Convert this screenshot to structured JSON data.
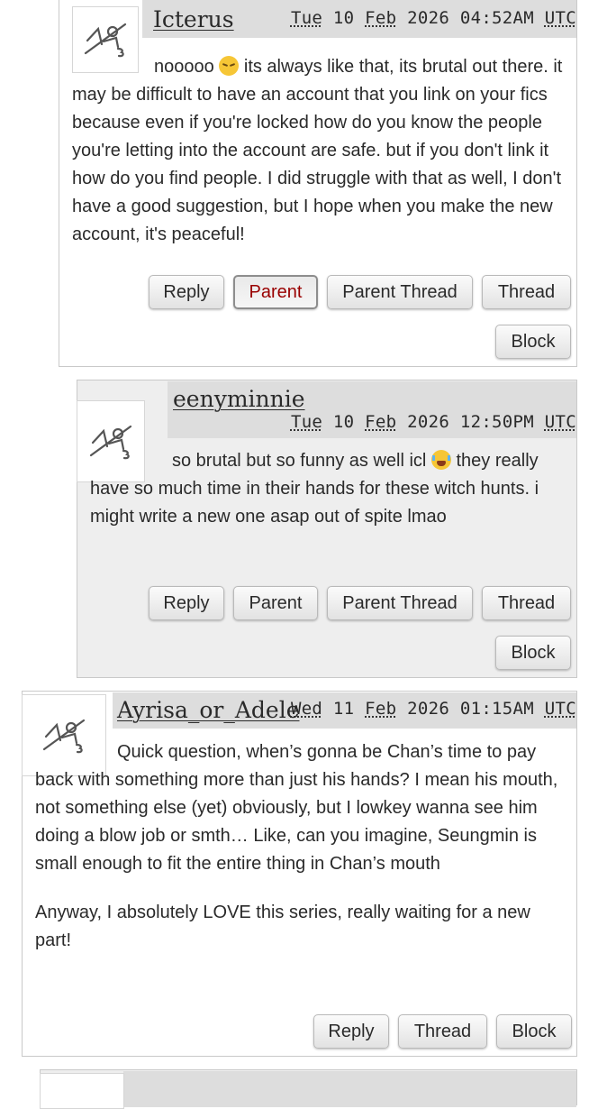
{
  "icons": {
    "default_avatar": "anonymous-user-icon"
  },
  "colors": {
    "active_link": "#990000",
    "nested_background": "#eeeeee",
    "byline_background": "#dddddd"
  },
  "comments": [
    {
      "username": "Icterus",
      "date": {
        "weekday": "Tue",
        "day": "10",
        "month": "Feb",
        "year": "2026",
        "time": "04:52AM",
        "zone": "UTC"
      },
      "body": [
        "nooooo",
        "its always like that, its brutal out there. it may be difficult to have an account that you link on your fics because even if you're locked how do you know the people you're letting into the account are safe. but if you don't link it how do you find people. I did struggle with that as well, I don't have a good suggestion, but I hope when you make the new account, it's peaceful!"
      ],
      "emoji": "pensive-face-icon",
      "actions": {
        "reply": "Reply",
        "parent": "Parent",
        "parent_thread": "Parent Thread",
        "thread": "Thread",
        "block": "Block"
      }
    },
    {
      "username": "eenyminnie",
      "date": {
        "weekday": "Tue",
        "day": "10",
        "month": "Feb",
        "year": "2026",
        "time": "12:50PM",
        "zone": "UTC"
      },
      "body": [
        "so brutal but so funny as well icl",
        "they really have so much time in their hands for these witch hunts. i might write a new one asap out of spite lmao"
      ],
      "emoji": "loudly-crying-face-icon",
      "actions": {
        "reply": "Reply",
        "parent": "Parent",
        "parent_thread": "Parent Thread",
        "thread": "Thread",
        "block": "Block"
      }
    },
    {
      "username": "Ayrisa_or_Adele",
      "date": {
        "weekday": "Wed",
        "day": "11",
        "month": "Feb",
        "year": "2026",
        "time": "01:15AM",
        "zone": "UTC"
      },
      "body": [
        "Quick question, when’s gonna be Chan’s time to pay back with something more than just his hands? I mean his mouth, not something else (yet) obviously, but I lowkey wanna see him doing a blow job or smth… Like, can you imagine, Seungmin is small enough to fit the entire thing in Chan’s mouth",
        "Anyway, I absolutely LOVE this series, really waiting for a new part!"
      ],
      "actions": {
        "reply": "Reply",
        "thread": "Thread",
        "block": "Block"
      }
    }
  ]
}
